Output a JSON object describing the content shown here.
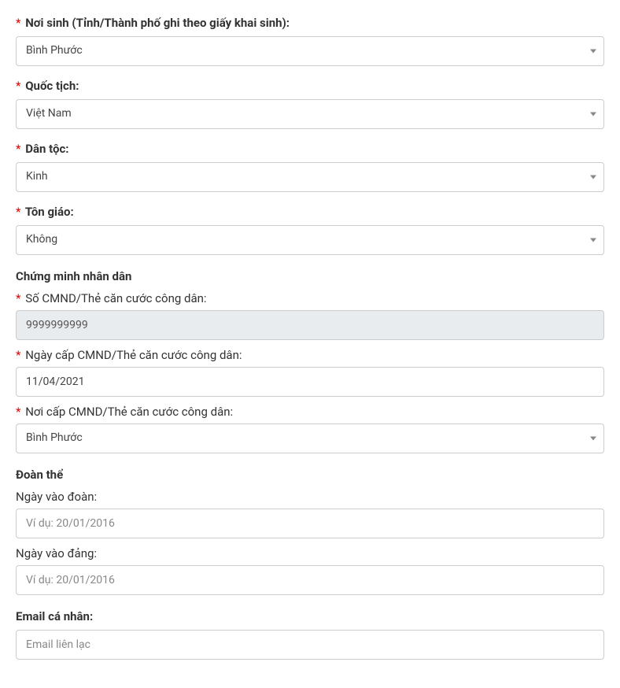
{
  "birthplace": {
    "label": "Nơi sinh (Tỉnh/Thành phố ghi theo giấy khai sinh):",
    "value": "Bình Phước"
  },
  "nationality": {
    "label": "Quốc tịch:",
    "value": "Việt Nam"
  },
  "ethnicity": {
    "label": "Dân tộc:",
    "value": "Kinh"
  },
  "religion": {
    "label": "Tôn giáo:",
    "value": "Không"
  },
  "id_section": {
    "heading": "Chứng minh nhân dân",
    "number": {
      "label": "Số CMND/Thẻ căn cước công dân:",
      "value": "9999999999"
    },
    "issue_date": {
      "label": "Ngày cấp CMND/Thẻ căn cước công dân:",
      "value": "11/04/2021"
    },
    "issue_place": {
      "label": "Nơi cấp CMND/Thẻ căn cước công dân:",
      "value": "Bình Phước"
    }
  },
  "org_section": {
    "heading": "Đoàn thể",
    "youth_union": {
      "label": "Ngày vào đoàn:",
      "placeholder": "Ví dụ: 20/01/2016"
    },
    "party": {
      "label": "Ngày vào đảng:",
      "placeholder": "Ví dụ: 20/01/2016"
    }
  },
  "email": {
    "label": "Email cá nhân:",
    "placeholder": "Email liên lạc"
  }
}
